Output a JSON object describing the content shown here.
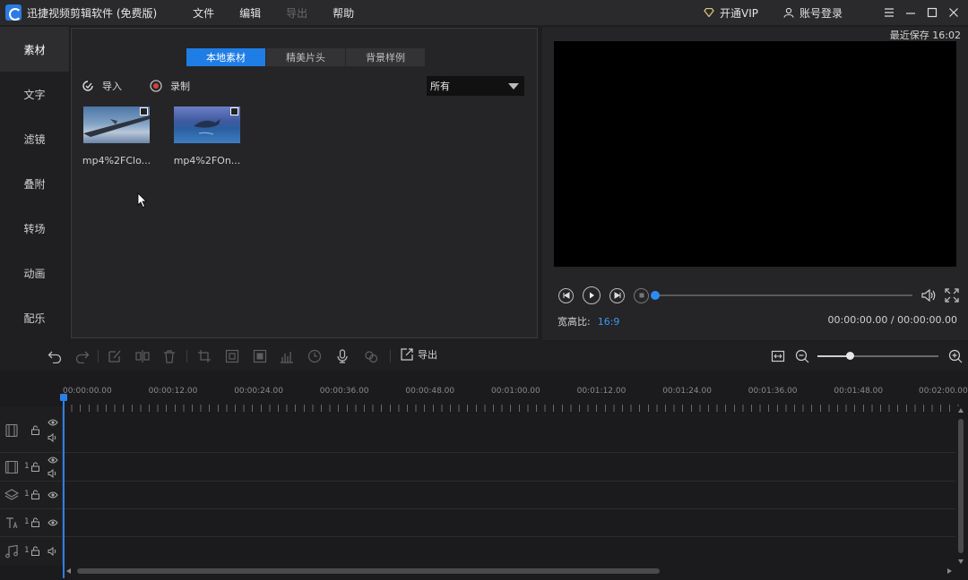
{
  "app": {
    "title": "迅捷视频剪辑软件 (免费版)",
    "menu": [
      "文件",
      "编辑",
      "导出",
      "帮助"
    ],
    "vip_label": "开通VIP",
    "account_label": "账号登录"
  },
  "sidebar": {
    "items": [
      "素材",
      "文字",
      "滤镜",
      "叠附",
      "转场",
      "动画",
      "配乐"
    ],
    "active": "素材"
  },
  "media": {
    "tabs": [
      "本地素材",
      "精美片头",
      "背景样例"
    ],
    "active_tab": "本地素材",
    "import_label": "导入",
    "record_label": "录制",
    "filter_value": "所有",
    "files": [
      {
        "name": "mp4%2FClo..."
      },
      {
        "name": "mp4%2FOn..."
      }
    ]
  },
  "preview": {
    "last_saved": "最近保存 16:02",
    "aspect_label": "宽高比:",
    "aspect_value": "16:9",
    "timecode": "00:00:00.00 / 00:00:00.00",
    "progress": 0
  },
  "toolbar": {
    "export_label": "导出",
    "zoom": 0.27
  },
  "timeline": {
    "ruler_labels": [
      "00:00:00.00",
      "00:00:12.00",
      "00:00:24.00",
      "00:00:36.00",
      "00:00:48.00",
      "00:01:00.00",
      "00:01:12.00",
      "00:01:24.00",
      "00:01:36.00",
      "00:01:48.00",
      "00:02:00.00"
    ],
    "tracks": [
      {
        "type": "video",
        "number": ""
      },
      {
        "type": "film",
        "number": "1"
      },
      {
        "type": "layer",
        "number": "1"
      },
      {
        "type": "text",
        "number": "1"
      },
      {
        "type": "music",
        "number": "1"
      }
    ]
  },
  "colors": {
    "accent": "#1f7de6",
    "playhead": "#2d7fe8",
    "background": "#1e1e20"
  }
}
